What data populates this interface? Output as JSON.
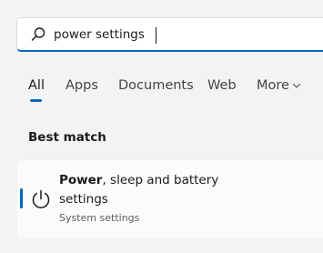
{
  "search": {
    "value": "power settings",
    "placeholder": "",
    "icon": "search-icon"
  },
  "tabs": [
    {
      "label": "All",
      "active": true
    },
    {
      "label": "Apps",
      "active": false
    },
    {
      "label": "Documents",
      "active": false
    },
    {
      "label": "Web",
      "active": false
    },
    {
      "label": "More",
      "active": false,
      "icon": "chevron-down-icon"
    }
  ],
  "best_match": {
    "section_label": "Best match",
    "result": {
      "title_bold": "Power",
      "title_rest": ", sleep and battery settings",
      "subtitle": "System settings",
      "icon": "power-icon"
    }
  },
  "colors": {
    "accent": "#0067c0",
    "background": "#f3f3f3",
    "card": "#fbfbfb",
    "text": "#1a1a1a",
    "muted": "#5c5c5c"
  }
}
